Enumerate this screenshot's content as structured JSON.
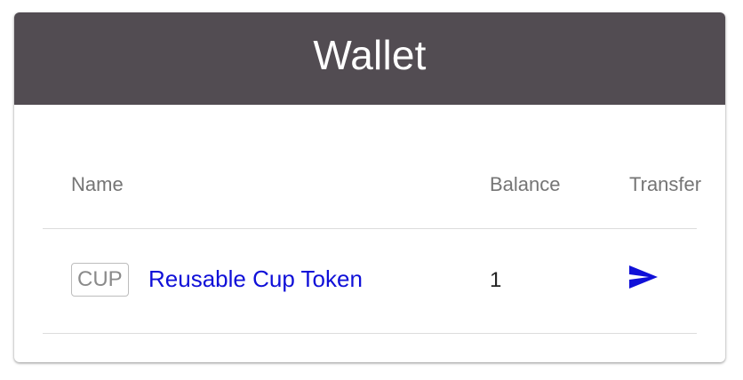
{
  "header": {
    "title": "Wallet"
  },
  "table": {
    "columns": {
      "name": "Name",
      "balance": "Balance",
      "transfer": "Transfer"
    },
    "rows": [
      {
        "symbol": "CUP",
        "name": "Reusable Cup Token",
        "balance": "1",
        "transfer_icon": "send-icon"
      }
    ]
  },
  "colors": {
    "header_bg": "#524c52",
    "link": "#1010d8",
    "muted_text": "#757575"
  }
}
